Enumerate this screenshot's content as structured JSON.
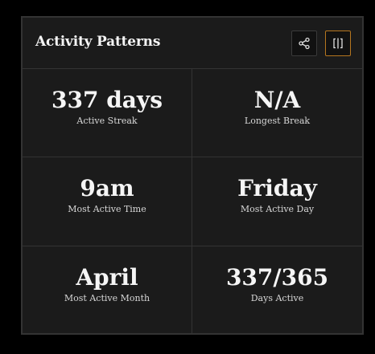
{
  "card": {
    "title": "Activity Patterns",
    "actions": {
      "share_icon": "share-icon",
      "toggle_icon": "split-view-icon",
      "active_border_color": "#b5761f"
    }
  },
  "stats": [
    {
      "value": "337 days",
      "label": "Active Streak"
    },
    {
      "value": "N/A",
      "label": "Longest Break"
    },
    {
      "value": "9am",
      "label": "Most Active Time"
    },
    {
      "value": "Friday",
      "label": "Most Active Day"
    },
    {
      "value": "April",
      "label": "Most Active Month"
    },
    {
      "value": "337/365",
      "label": "Days Active"
    }
  ]
}
